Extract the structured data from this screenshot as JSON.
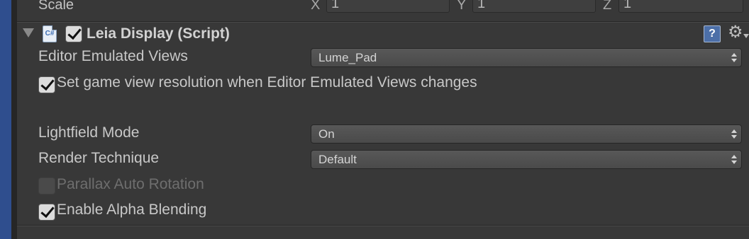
{
  "scale": {
    "label": "Scale",
    "x_label": "X",
    "x_value": "1",
    "y_label": "Y",
    "y_value": "1",
    "z_label": "Z",
    "z_value": "1"
  },
  "component": {
    "title": "Leia Display (Script)",
    "enabled": true,
    "icons": [
      "foldout-icon",
      "script-icon",
      "help-icon",
      "gear-icon"
    ],
    "script_icon_text": "C#",
    "help_icon_text": "?",
    "gear_glyph": "⚙"
  },
  "properties": {
    "editor_emulated_views": {
      "label": "Editor Emulated Views",
      "value": "Lume_Pad"
    },
    "set_game_view_resolution": {
      "label": "Set game view resolution when Editor Emulated Views changes",
      "checked": true
    },
    "lightfield_mode": {
      "label": "Lightfield Mode",
      "value": "On"
    },
    "render_technique": {
      "label": "Render Technique",
      "value": "Default"
    },
    "parallax_auto_rotation": {
      "label": "Parallax Auto Rotation",
      "checked": false,
      "disabled": true
    },
    "enable_alpha_blending": {
      "label": "Enable Alpha Blending",
      "checked": true
    }
  },
  "colors": {
    "background": "#383838",
    "left_strip": "#2f4e8e",
    "text": "#c8c8c8",
    "disabled_text": "#6e6e6e"
  }
}
